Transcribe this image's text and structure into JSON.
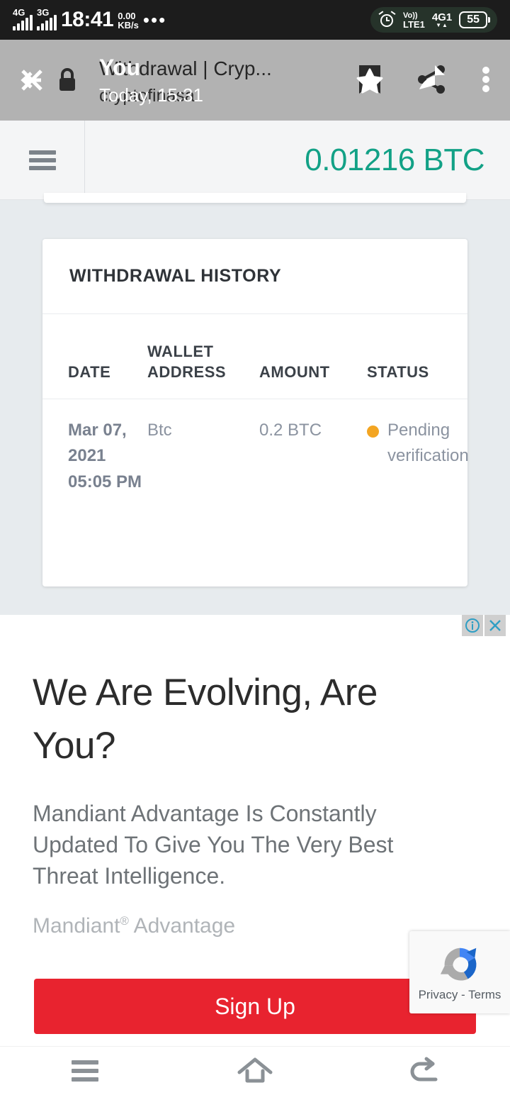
{
  "status_bar": {
    "network_primary": "4G",
    "network_secondary": "3G",
    "clock": "18:41",
    "data_speed_value": "0.00",
    "data_speed_unit": "KB/s",
    "overflow_dots": "•••",
    "volte_label": "Vo))",
    "volte_network": "LTE1",
    "right_network": "4G",
    "right_network_sub": "1",
    "data_arrows": "▼▲",
    "battery_level": "55"
  },
  "browser_toolbar": {
    "page_title": "Withdrawal | Cryp...",
    "page_subtitle": "cryptofinasa",
    "overlay_title": "You",
    "overlay_subtitle": "Today, 15:31",
    "icons": {
      "close": "close-icon",
      "back": "back-arrow-icon",
      "lock": "lock-icon",
      "bookmark": "bookmark-star-icon",
      "share": "share-icon",
      "overflow": "more-vertical-icon"
    }
  },
  "balance_bar": {
    "menu_icon": "hamburger-menu-icon",
    "balance": "0.01216 BTC",
    "balance_color": "#12a186"
  },
  "withdrawal_card": {
    "title": "WITHDRAWAL HISTORY",
    "columns": [
      "DATE",
      "WALLET ADDRESS",
      "AMOUNT",
      "STATUS"
    ],
    "rows": [
      {
        "date": "Mar 07, 2021 05:05 PM",
        "wallet_address": "Btc",
        "amount": "0.2 BTC",
        "status": "Pending verification",
        "status_color": "#f3a522"
      }
    ]
  },
  "advertisement": {
    "info_badge": "adchoices-info-icon",
    "close_badge": "✕",
    "headline": "We Are Evolving, Are You?",
    "body": "Mandiant Advantage Is Constantly Updated To Give You The Very Best Threat Intelligence.",
    "advertiser_name": "Mandiant",
    "advertiser_mark": "®",
    "advertiser_product": "Advantage",
    "cta_label": "Sign Up",
    "cta_color": "#e8232f"
  },
  "recaptcha": {
    "label": "Privacy - Terms"
  },
  "nav_bar": {
    "recents": "recents-icon",
    "home": "home-icon",
    "back": "back-icon"
  }
}
